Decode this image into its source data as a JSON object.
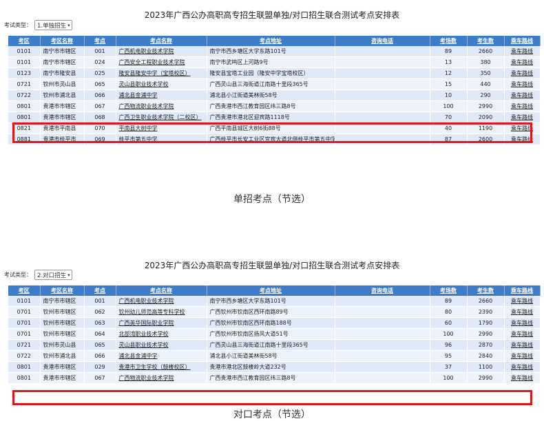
{
  "colors": {
    "header_bg": "#3d7cc9",
    "row_a": "#dfe9f8",
    "row_b": "#eef3fb",
    "highlight": "#e0161d"
  },
  "columns": [
    "考区",
    "考区名称",
    "考点",
    "考点名称",
    "考点地址",
    "咨询电话",
    "考场数",
    "考生数",
    "乘车路线"
  ],
  "panel1": {
    "title": "2023年广西公办高职高专招生联盟单独/对口招生联合测试考点安排表",
    "filter_label": "考试类型：",
    "filter_value": "1.单独招生",
    "rows": [
      [
        "0101",
        "南宁市市辖区",
        "001",
        "广西机电职业技术学院",
        "南宁市西乡塘区大学东路101号",
        "",
        "89",
        "2660",
        "乘车路线"
      ],
      [
        "0101",
        "南宁市市辖区",
        "024",
        "广西安全工程职业技术学院",
        "南宁市武鸣区上河路9号",
        "",
        "13",
        "380",
        "乘车路线"
      ],
      [
        "0123",
        "南宁市隆安县",
        "025",
        "隆安县隆安中学（宝塔校区）",
        "隆安县宝塔工业园（隆安中学宝塔校区）",
        "",
        "12",
        "350",
        "乘车路线"
      ],
      [
        "0721",
        "钦州市灵山县",
        "065",
        "灵山县职业技术学校",
        "广西灵山县三海街道江南路十里段365号",
        "",
        "15",
        "440",
        "乘车路线"
      ],
      [
        "0722",
        "钦州市浦北县",
        "066",
        "浦北县金浦中学",
        "浦北县小江街道美林街58号",
        "",
        "10",
        "290",
        "乘车路线"
      ],
      [
        "0801",
        "贵港市市辖区",
        "067",
        "广西物流职业技术学院",
        "广西贵港市西江教育园区纬三路8号",
        "",
        "100",
        "2990",
        "乘车路线"
      ],
      [
        "0801",
        "贵港市市辖区",
        "068",
        "广西卫生职业技术学院（二校区）",
        "广西贵港市港北区迎宾路1118号",
        "",
        "70",
        "2090",
        "乘车路线"
      ],
      [
        "0821",
        "贵港市平南县",
        "070",
        "平南县大树中学",
        "广西平南县城区大树6街88号",
        "",
        "40",
        "1190",
        "乘车路线"
      ],
      [
        "0881",
        "贵港市桂平市",
        "069",
        "桂平市第五中学",
        "广西桂平市长安工业区宜宾大道北侧桂平市第五中学",
        "",
        "87",
        "2600",
        "乘车路线"
      ]
    ],
    "caption": "单招考点（节选）"
  },
  "panel2": {
    "title": "2023年广西公办高职高专招生联盟单独/对口招生联合测试考点安排表",
    "filter_label": "考试类型：",
    "filter_value": "2.对口招生",
    "rows": [
      [
        "0101",
        "南宁市市辖区",
        "001",
        "广西机电职业技术学院",
        "南宁市西乡塘区大学东路101号",
        "",
        "89",
        "2660",
        "乘车路线"
      ],
      [
        "0701",
        "钦州市市辖区",
        "062",
        "钦州幼儿师范高等专科学校",
        "广西钦州市钦南区西环南路89号",
        "",
        "80",
        "2390",
        "乘车路线"
      ],
      [
        "0701",
        "钦州市市辖区",
        "063",
        "广西英华国际职业学院",
        "广西钦州市钦南区西环南路188号",
        "",
        "60",
        "1790",
        "乘车路线"
      ],
      [
        "0701",
        "钦州市市辖区",
        "064",
        "北部湾职业技术学校",
        "广西钦州市钦南区扬风大道51号",
        "",
        "100",
        "2990",
        "乘车路线"
      ],
      [
        "0721",
        "钦州市灵山县",
        "065",
        "灵山县职业技术学校",
        "广西灵山县三海街道江南路十里段365号",
        "",
        "96",
        "2870",
        "乘车路线"
      ],
      [
        "0722",
        "钦州市浦北县",
        "066",
        "浦北县金浦中学",
        "浦北县小江街道美林街58号",
        "",
        "95",
        "2840",
        "乘车路线"
      ],
      [
        "0801",
        "贵港市市辖区",
        "029",
        "贵港市卫生学校（鼓楼校区）",
        "贵港市港北区鼓楼岭大道232号",
        "",
        "37",
        "1100",
        "乘车路线"
      ],
      [
        "0801",
        "贵港市市辖区",
        "067",
        "广西物流职业技术学院",
        "广西贵港市西江教育园区纬三路8号",
        "",
        "100",
        "2990",
        "乘车路线"
      ]
    ],
    "caption": "对口考点（节选）"
  }
}
